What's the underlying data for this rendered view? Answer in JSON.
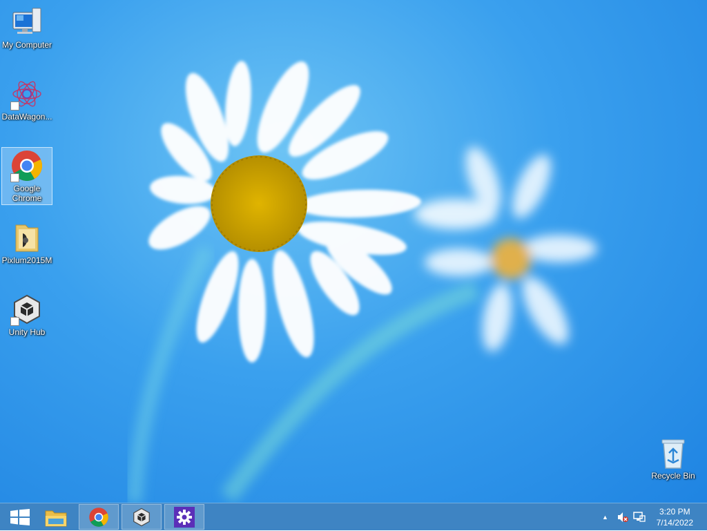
{
  "desktop": {
    "icons": [
      {
        "name": "my-computer",
        "label": "My Computer"
      },
      {
        "name": "datawagon",
        "label": "DataWagon..."
      },
      {
        "name": "google-chrome",
        "label": "Google Chrome"
      },
      {
        "name": "pixlum",
        "label": "Pixlum2015M"
      },
      {
        "name": "unity-hub",
        "label": "Unity Hub"
      },
      {
        "name": "recycle-bin",
        "label": "Recycle Bin"
      }
    ]
  },
  "taskbar": {
    "start_icon": "windows-logo-icon",
    "pinned": [
      "file-explorer-icon",
      "chrome-icon",
      "unity-icon",
      "settings-gear-icon"
    ],
    "tray": {
      "icons": [
        "show-hidden-icons-chevron-icon",
        "volume-muted-icon",
        "network-icon"
      ]
    },
    "clock": {
      "time": "3:20 PM",
      "date": "7/14/2022"
    }
  },
  "colors": {
    "desktop_blue": "#2a90e8",
    "taskbar": "#2e7abe",
    "chrome_red": "#db4437",
    "chrome_yellow": "#f4b400",
    "chrome_green": "#0f9d58",
    "chrome_blue": "#4285f4",
    "settings_purple": "#5b2fb8"
  }
}
